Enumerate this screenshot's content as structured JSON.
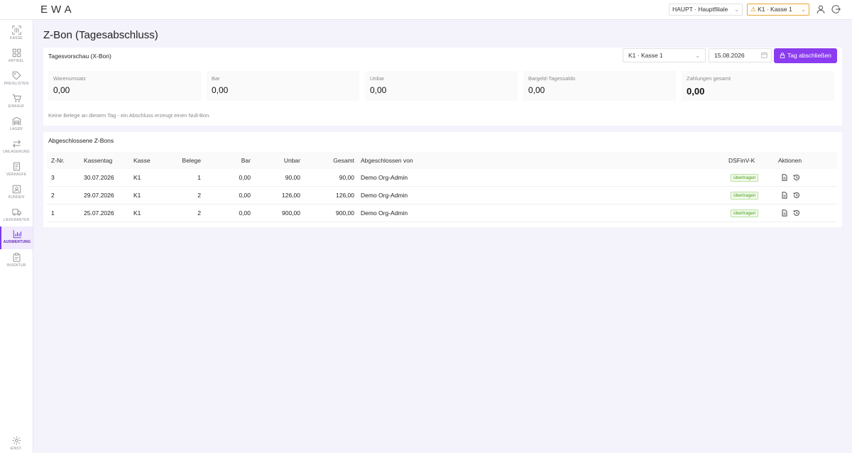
{
  "app": {
    "logo": "EWA"
  },
  "header": {
    "branch": "HAUPT · Hauptfiliale",
    "register": "K1 · Kasse 1",
    "warn_icon": "warning-icon",
    "warn_color": "#e9a93a",
    "icons": [
      "user-icon",
      "logout-icon"
    ]
  },
  "sidebar": {
    "active_color": "#7c3aed",
    "items": [
      {
        "label": "KASSE",
        "icon": "scan-icon"
      },
      {
        "label": "ARTIKEL",
        "icon": "grid-icon"
      },
      {
        "label": "PREISLISTEN",
        "icon": "tag-icon"
      },
      {
        "label": "EINKAUF",
        "icon": "cart-icon"
      },
      {
        "label": "LAGER",
        "icon": "warehouse-icon"
      },
      {
        "label": "UMLAGERUNG",
        "icon": "transfer-icon"
      },
      {
        "label": "VERKÄUFE",
        "icon": "receipt-icon"
      },
      {
        "label": "KUNDEN",
        "icon": "customer-icon"
      },
      {
        "label": "LIEFERANTEN",
        "icon": "truck-icon"
      },
      {
        "label": "AUSWERTUNG",
        "icon": "chart-icon",
        "active": true
      },
      {
        "label": "INVENTUR",
        "icon": "clipboard-icon"
      }
    ],
    "settings": {
      "label": "EINST.",
      "icon": "gear-icon"
    }
  },
  "page": {
    "title": "Z-Bon (Tagesabschluss)"
  },
  "preview": {
    "title": "Tagesvorschau (X-Bon)",
    "register_select": "K1 · Kasse 1",
    "date": "15.08.2026",
    "close_button": "Tag abschließen",
    "button_color": "#8b3cf0",
    "stats": [
      {
        "label": "Warenumsatz",
        "value": "0,00"
      },
      {
        "label": "Bar",
        "value": "0,00"
      },
      {
        "label": "Unbar",
        "value": "0,00"
      },
      {
        "label": "Bargeld-Tagessaldo",
        "value": "0,00"
      },
      {
        "label": "Zahlungen gesamt",
        "value": "0,00"
      }
    ],
    "note": "Keine Belege an diesem Tag - ein Abschluss erzeugt einen Null-Bon."
  },
  "closed": {
    "title": "Abgeschlossene Z-Bons",
    "headers": {
      "znr": "Z-Nr.",
      "day": "Kassentag",
      "register": "Kasse",
      "receipts": "Belege",
      "cash": "Bar",
      "noncash": "Unbar",
      "total": "Gesamt",
      "closed_by": "Abgeschlossen von",
      "dsfinv": "DSFinV-K",
      "actions": "Aktionen"
    },
    "badge_color": "#4a9d22",
    "rows": [
      {
        "znr": "3",
        "day": "30.07.2026",
        "register": "K1",
        "receipts": "1",
        "cash": "0,00",
        "noncash": "90,00",
        "total": "90,00",
        "closed_by": "Demo Org-Admin",
        "dsfinv": "übertragen"
      },
      {
        "znr": "2",
        "day": "29.07.2026",
        "register": "K1",
        "receipts": "2",
        "cash": "0,00",
        "noncash": "126,00",
        "total": "126,00",
        "closed_by": "Demo Org-Admin",
        "dsfinv": "übertragen"
      },
      {
        "znr": "1",
        "day": "25.07.2026",
        "register": "K1",
        "receipts": "2",
        "cash": "0,00",
        "noncash": "900,00",
        "total": "900,00",
        "closed_by": "Demo Org-Admin",
        "dsfinv": "übertragen"
      }
    ],
    "row_actions": [
      "document-icon",
      "history-icon"
    ]
  }
}
